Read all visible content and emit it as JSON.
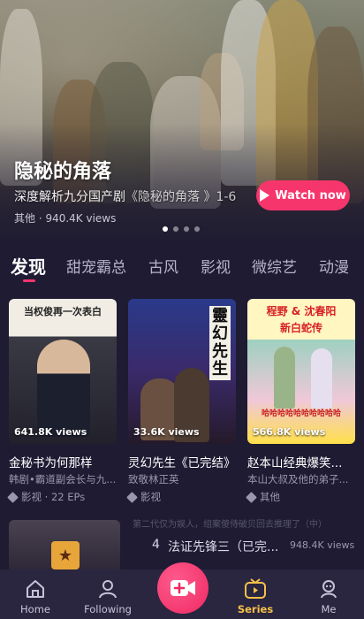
{
  "hero": {
    "title": "隐秘的角落",
    "subtitle": "深度解析九分国产剧",
    "overlay_text": "《隐秘的角落 》1-6",
    "meta": "其他 · 940.4K views",
    "watch_label": "Watch now",
    "slides_total": 4,
    "slide_active": 1
  },
  "tabs": [
    "发现",
    "甜宠霸总",
    "古风",
    "影视",
    "微综艺",
    "动漫"
  ],
  "cards": [
    {
      "title": "金秘书为何那样",
      "subtitle": "韩剧•霸道副会长与九...",
      "tag": "影视 · 22 EPs",
      "views": "641.8K views",
      "poster_text": "当权俊再一次表白"
    },
    {
      "title": "灵幻先生《已完结》",
      "subtitle": "致敬林正英",
      "tag": "影视",
      "views": "33.6K views",
      "poster_text": "靈幻先生"
    },
    {
      "title": "赵本山经典爆笑...",
      "subtitle": "本山大叔及他的弟子...",
      "tag": "其他",
      "views": "566.8K views",
      "poster_text_top": "程野 & 沈春阳",
      "poster_text_sub": "新白蛇传",
      "poster_text_bottom": "哈哈哈哈哈哈哈哈哈哈"
    }
  ],
  "row2": {
    "number": "4",
    "title": "法证先锋三（已完...",
    "views": "948.4K views",
    "faded_text": "第二代仅为娱人，组案傻侍破贝回去推理了（中）"
  },
  "nav": {
    "home": "Home",
    "following": "Following",
    "series": "Series",
    "me": "Me"
  },
  "colors": {
    "accent": "#f7356d",
    "active_nav": "#f6c04a",
    "background": "#1e1b33"
  }
}
